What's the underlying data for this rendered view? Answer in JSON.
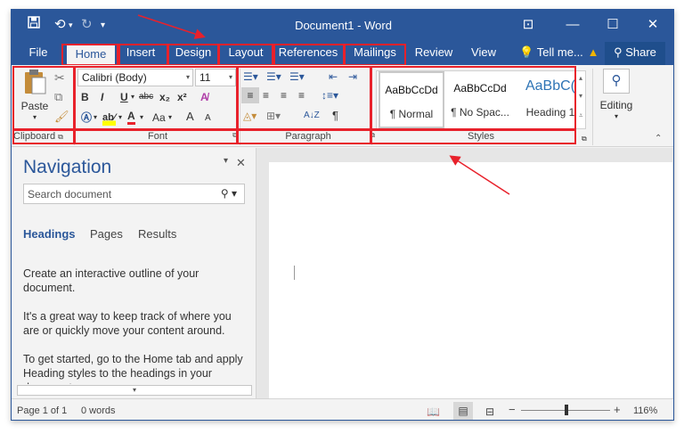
{
  "window": {
    "title": "Document1 - Word"
  },
  "quick_access": {
    "save_icon": "save-icon",
    "undo_icon": "undo-icon",
    "redo_icon": "redo-icon",
    "customize_icon": "customize-icon"
  },
  "title_controls": {
    "ribbon_display": "ribbon-display-icon",
    "minimize": "minimize-icon",
    "maximize": "maximize-icon",
    "close": "close-icon"
  },
  "tabs": [
    "File",
    "Home",
    "Insert",
    "Design",
    "Layout",
    "References",
    "Mailings",
    "Review",
    "View"
  ],
  "active_tab": "Home",
  "tell_me": "Tell me...",
  "share": "Share",
  "clipboard": {
    "paste": "Paste",
    "label": "Clipboard"
  },
  "font": {
    "family": "Calibri (Body)",
    "size": "11",
    "bold": "B",
    "italic": "I",
    "underline": "U",
    "strike": "abc",
    "subscript": "x₂",
    "superscript": "x²",
    "case": "Aa",
    "grow": "A",
    "shrink": "A",
    "label": "Font"
  },
  "paragraph": {
    "label": "Paragraph",
    "sort": "A↓Z",
    "pilcrow": "¶"
  },
  "styles": {
    "items": [
      {
        "preview": "AaBbCcDd",
        "name": "¶ Normal"
      },
      {
        "preview": "AaBbCcDd",
        "name": "¶ No Spac..."
      },
      {
        "preview": "AaBbC(",
        "name": "Heading 1"
      }
    ],
    "label": "Styles"
  },
  "editing": {
    "label": "Editing"
  },
  "navigation": {
    "title": "Navigation",
    "search_placeholder": "Search document",
    "tabs": [
      "Headings",
      "Pages",
      "Results"
    ],
    "paragraphs": [
      "Create an interactive outline of your document.",
      "It's a great way to keep track of where you are or quickly move your content around.",
      "To get started, go to the Home tab and apply Heading styles to the headings in your document."
    ]
  },
  "status": {
    "page": "Page 1 of 1",
    "words": "0 words",
    "zoom": "116%"
  },
  "colors": {
    "brand": "#2b579a",
    "highlight_box": "#e8212b",
    "ribbon_bg": "#f3f3f3",
    "font_color": "#e8212b",
    "highlight_color": "#ffff00"
  }
}
